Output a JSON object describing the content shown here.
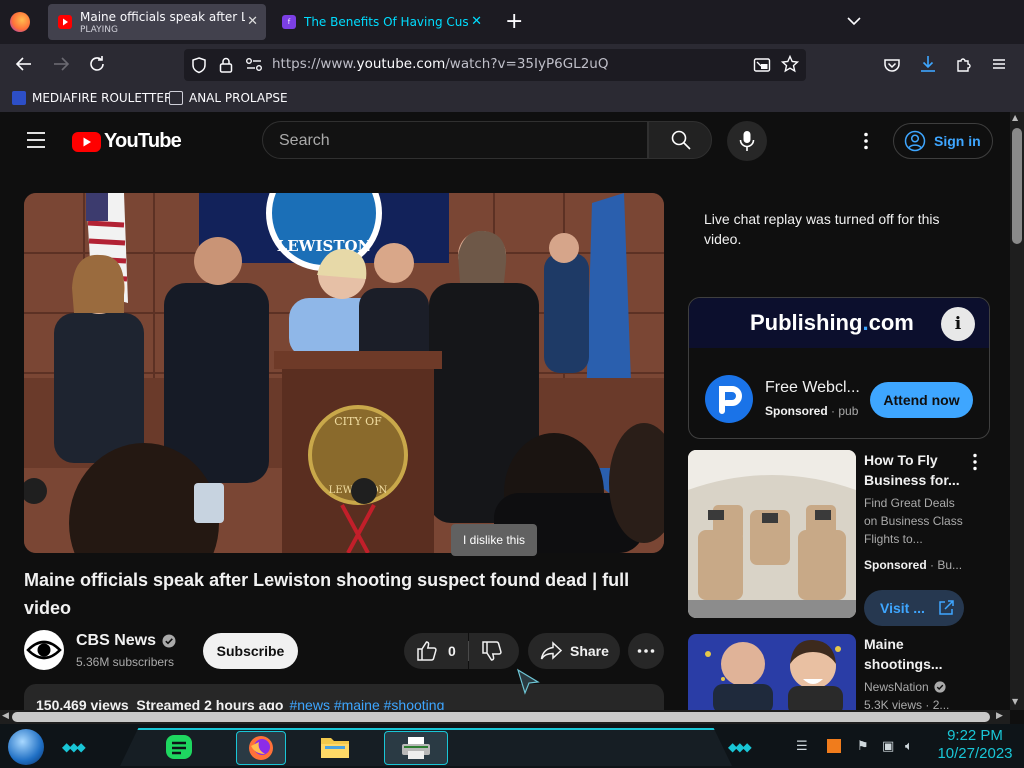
{
  "browser": {
    "tabs": [
      {
        "title": "Maine officials speak after Lewiston shooting suspect found dead",
        "subtitle": "PLAYING",
        "active": true
      },
      {
        "title": "The Benefits Of Having Custom",
        "active": false
      }
    ],
    "new_tab_label": "+",
    "url_prefix": "https://www.",
    "url_domain": "youtube.com",
    "url_path": "/watch?v=35IyP6GL2uQ",
    "bookmarks": [
      {
        "label": "MEDIAFIRE ROULETTER"
      },
      {
        "label": "ANAL PROLAPSE"
      }
    ]
  },
  "youtube": {
    "logo_text": "YouTube",
    "search_placeholder": "Search",
    "sign_in_label": "Sign in",
    "video": {
      "title": "Maine officials speak after Lewiston shooting suspect found dead | full video",
      "tooltip": "I dislike this",
      "podium_seal_text": "CITY OF",
      "podium_seal_bottom": "LEWISTON",
      "banner_text": "LEWISTON"
    },
    "channel": {
      "name": "CBS News",
      "subscribers": "5.36M subscribers",
      "subscribe_label": "Subscribe"
    },
    "actions": {
      "like_count": "0",
      "share_label": "Share"
    },
    "description": {
      "views_line": "150,469 views  Streamed 2 hours ago",
      "tags": "#news #maine #shooting"
    },
    "chat_message": "Live chat replay was turned off for this video.",
    "ad": {
      "logo": "Publishing",
      "logo_dot": ".",
      "logo_tld": "com",
      "info_glyph": "i",
      "title": "Free Webcl...",
      "sponsored": "Sponsored",
      "sponsor_suffix": "pub",
      "cta": "Attend now"
    },
    "recommendations": [
      {
        "title": "How To Fly Business for...",
        "desc": "Find Great Deals on Business Class Flights to...",
        "sponsored": "Sponsored",
        "sponsor_suffix": "Bu...",
        "cta": "Visit ..."
      },
      {
        "title": "Maine shootings...",
        "channel": "NewsNation",
        "meta": "5.3K views",
        "meta_suffix": "2..."
      }
    ]
  },
  "taskbar": {
    "time": "9:22 PM",
    "date": "10/27/2023"
  },
  "colors": {
    "youtube_red": "#ff0000",
    "link_blue": "#3ea6ff",
    "taskbar_accent": "#19c6d6",
    "firefox_orange": "#ff7139"
  }
}
